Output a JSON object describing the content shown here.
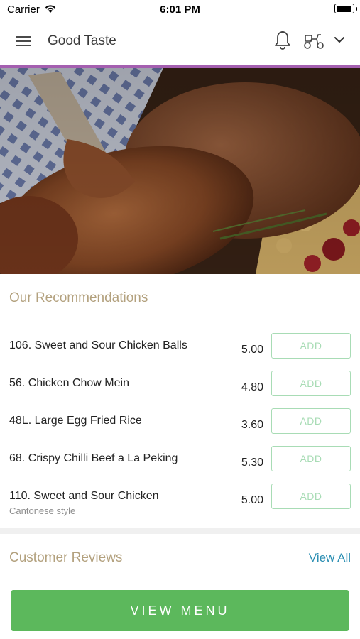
{
  "status_bar": {
    "carrier": "Carrier",
    "time": "6:01 PM"
  },
  "navbar": {
    "title": "Good Taste",
    "menu_icon": "hamburger-menu-icon",
    "notification_icon": "bell-icon",
    "delivery_icon": "scooter-icon",
    "dropdown_icon": "chevron-down-icon",
    "accent_color": "#a45fb0"
  },
  "hero": {
    "image_description": "roast duck photo"
  },
  "recommendations": {
    "title": "Our Recommendations",
    "add_label": "ADD",
    "items": [
      {
        "name": "106. Sweet and Sour Chicken Balls",
        "price": "5.00",
        "subtitle": ""
      },
      {
        "name": "56. Chicken Chow Mein",
        "price": "4.80",
        "subtitle": ""
      },
      {
        "name": "48L. Large Egg Fried Rice",
        "price": "3.60",
        "subtitle": ""
      },
      {
        "name": "68. Crispy Chilli Beef a La Peking",
        "price": "5.30",
        "subtitle": ""
      },
      {
        "name": "110. Sweet and Sour Chicken",
        "price": "5.00",
        "subtitle": "Cantonese style"
      }
    ]
  },
  "reviews": {
    "title": "Customer Reviews",
    "view_all_label": "View All"
  },
  "footer": {
    "view_menu_label": "VIEW MENU",
    "button_color": "#5cb85c"
  }
}
